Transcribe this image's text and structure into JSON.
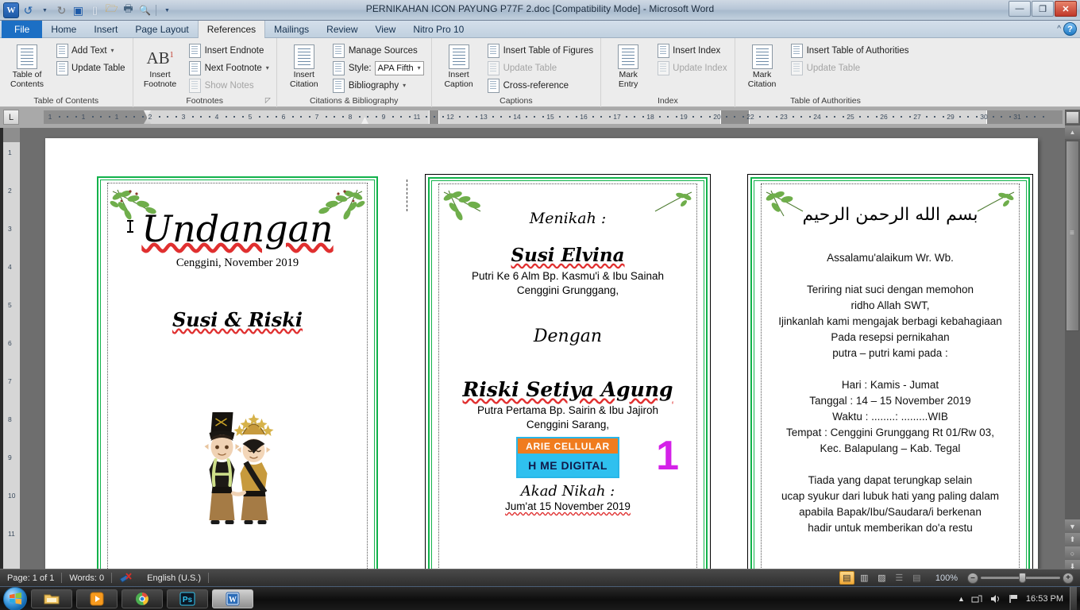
{
  "window": {
    "title": "PERNIKAHAN ICON PAYUNG P77F 2.doc [Compatibility Mode]  -  Microsoft Word",
    "minimize": "—",
    "restore": "❐",
    "close": "✕",
    "word_badge": "W"
  },
  "quick_access": {
    "items": [
      {
        "name": "undo-icon",
        "glyph": "↺"
      },
      {
        "name": "undo-dropdown-icon",
        "glyph": "▾"
      },
      {
        "name": "redo-icon",
        "glyph": "↻"
      },
      {
        "name": "save-icon",
        "glyph": "▣"
      },
      {
        "name": "new-icon",
        "glyph": "🗋"
      },
      {
        "name": "open-icon",
        "glyph": "🗁"
      },
      {
        "name": "print-icon",
        "glyph": "🖶"
      },
      {
        "name": "print-preview-icon",
        "glyph": "🔍"
      },
      {
        "name": "customize-qat-icon",
        "glyph": "▾"
      }
    ]
  },
  "tabs": [
    {
      "label": "File",
      "state": "file"
    },
    {
      "label": "Home",
      "state": "normal"
    },
    {
      "label": "Insert",
      "state": "normal"
    },
    {
      "label": "Page Layout",
      "state": "normal"
    },
    {
      "label": "References",
      "state": "active"
    },
    {
      "label": "Mailings",
      "state": "normal"
    },
    {
      "label": "Review",
      "state": "normal"
    },
    {
      "label": "View",
      "state": "normal"
    },
    {
      "label": "Nitro Pro 10",
      "state": "normal"
    }
  ],
  "help": {
    "collapse_ribbon": "^",
    "help": "?"
  },
  "ribbon": {
    "groups": [
      {
        "label": "Table of Contents",
        "big": {
          "label1": "Table of",
          "label2": "Contents",
          "dropdown": "▾"
        },
        "small": [
          {
            "label": "Add Text",
            "dropdown": "▾",
            "disabled": false
          },
          {
            "label": "Update Table",
            "dropdown": "",
            "disabled": false
          }
        ]
      },
      {
        "label": "Footnotes",
        "big": {
          "label1": "Insert",
          "label2": "Footnote",
          "glyph": "AB",
          "sup": "1"
        },
        "small": [
          {
            "label": "Insert Endnote",
            "dropdown": "",
            "disabled": false
          },
          {
            "label": "Next Footnote",
            "dropdown": "▾",
            "disabled": false
          },
          {
            "label": "Show Notes",
            "dropdown": "",
            "disabled": true
          }
        ],
        "launcher": "◸"
      },
      {
        "label": "Citations & Bibliography",
        "big": {
          "label1": "Insert",
          "label2": "Citation",
          "dropdown": "▾"
        },
        "small": [
          {
            "label": "Manage Sources",
            "dropdown": "",
            "disabled": false
          },
          {
            "label": "Style:",
            "dropdown": "",
            "disabled": false,
            "select_value": "APA Fifth",
            "select_arrow": "▾"
          },
          {
            "label": "Bibliography",
            "dropdown": "▾",
            "disabled": false
          }
        ]
      },
      {
        "label": "Captions",
        "big": {
          "label1": "Insert",
          "label2": "Caption"
        },
        "small": [
          {
            "label": "Insert Table of Figures",
            "dropdown": "",
            "disabled": false
          },
          {
            "label": "Update Table",
            "dropdown": "",
            "disabled": true
          },
          {
            "label": "Cross-reference",
            "dropdown": "",
            "disabled": false
          }
        ]
      },
      {
        "label": "Index",
        "big": {
          "label1": "Mark",
          "label2": "Entry"
        },
        "small": [
          {
            "label": "Insert Index",
            "dropdown": "",
            "disabled": false
          },
          {
            "label": "Update Index",
            "dropdown": "",
            "disabled": true
          }
        ]
      },
      {
        "label": "Table of Authorities",
        "big": {
          "label1": "Mark",
          "label2": "Citation"
        },
        "small": [
          {
            "label": "Insert Table of Authorities",
            "dropdown": "",
            "disabled": false
          },
          {
            "label": "Update Table",
            "dropdown": "",
            "disabled": true
          }
        ]
      }
    ]
  },
  "ruler": {
    "tab_stop_glyph": "L",
    "horizontal_ticks": [
      "1",
      "1",
      "1",
      "2",
      "3",
      "4",
      "5",
      "6",
      "7",
      "8",
      "9",
      "11",
      "12",
      "13",
      "14",
      "15",
      "16",
      "17",
      "18",
      "19",
      "20",
      "22",
      "23",
      "24",
      "25",
      "26",
      "27",
      "29",
      "30",
      "31"
    ],
    "vertical_ticks": [
      "1",
      "2",
      "3",
      "4",
      "5",
      "6",
      "7",
      "8",
      "9",
      "10",
      "11"
    ]
  },
  "document": {
    "card1": {
      "title": "Undangan",
      "place_date": "Cenggini, November 2019",
      "couple_names": "Susi & Riski",
      "illustration": "javanese-bride-groom-illustration"
    },
    "card2": {
      "heading": "Menikah :",
      "bride_name": "Susi Elvina",
      "bride_parents": "Putri Ke 6 Alm Bp. Kasmu'i & Ibu Sainah",
      "bride_address": "Cenggini Grunggang,",
      "connector": "Dengan",
      "groom_name": "Riski Setiya Agung",
      "groom_parents": "Putra Pertama Bp. Sairin  & Ibu Jajiroh",
      "groom_address": "Cenggini Sarang,",
      "logo_top": "ARIE CELLULAR",
      "logo_bottom": "H   ME DIGITAL",
      "page_number": "1",
      "akad_heading": "Akad Nikah :",
      "akad_date": "Jum'at 15 November 2019"
    },
    "card3": {
      "bismillah": "بسم الله الرحمن الرحيم",
      "salam": "Assalamu'alaikum Wr. Wb.",
      "body1": "Teriring niat suci dengan memohon",
      "body2": "ridho Allah SWT,",
      "body3": "Ijinkanlah kami mengajak berbagi kebahagiaan",
      "body4": "Pada resepsi pernikahan",
      "body5": "putra – putri kami pada :",
      "day": "Hari : Kamis - Jumat",
      "date": "Tanggal : 14 – 15 November 2019",
      "time": "Waktu : ........: .........WIB",
      "place": "Tempat : Cenggini Grunggang Rt 01/Rw 03,",
      "place2": "Kec. Balapulang – Kab. Tegal",
      "closing1": "Tiada yang dapat terungkap selain",
      "closing2": "ucap syukur dari lubuk hati yang paling dalam",
      "closing3": "apabila Bapak/Ibu/Saudara/i berkenan",
      "closing4": "hadir untuk memberikan  do'a restu"
    }
  },
  "status_bar": {
    "page": "Page: 1 of 1",
    "words": "Words: 0",
    "proofing_icon": "spellcheck-error-icon",
    "language": "English (U.S.)",
    "zoom_level": "100%",
    "zoom_out": "–",
    "zoom_in": "+",
    "views": [
      {
        "name": "print-layout-view",
        "glyph": "▤",
        "selected": true
      },
      {
        "name": "full-screen-reading-view",
        "glyph": "▥",
        "selected": false
      },
      {
        "name": "web-layout-view",
        "glyph": "▨",
        "selected": false
      },
      {
        "name": "outline-view",
        "glyph": "☰",
        "selected": false
      },
      {
        "name": "draft-view",
        "glyph": "▤",
        "selected": false
      }
    ]
  },
  "scrollbar": {
    "up_arrow": "▲",
    "down_arrow": "▼",
    "prev_page": "⬆",
    "select_browse_object": "○",
    "next_page": "⬇"
  },
  "taskbar": {
    "start": "start-orb",
    "buttons": [
      {
        "name": "taskbar-explorer",
        "glyph": "🗂",
        "active": false
      },
      {
        "name": "taskbar-media-player",
        "glyph": "▶",
        "active": false
      },
      {
        "name": "taskbar-chrome",
        "glyph": "◉",
        "active": false
      },
      {
        "name": "taskbar-photoshop",
        "glyph": "Ps",
        "active": false
      },
      {
        "name": "taskbar-word",
        "glyph": "W",
        "active": true
      }
    ],
    "tray": {
      "show_hidden": "▲",
      "network_icon": "🖧",
      "volume_icon": "🔊",
      "action_center_icon": "⚑",
      "clock": "16:53 PM"
    }
  }
}
